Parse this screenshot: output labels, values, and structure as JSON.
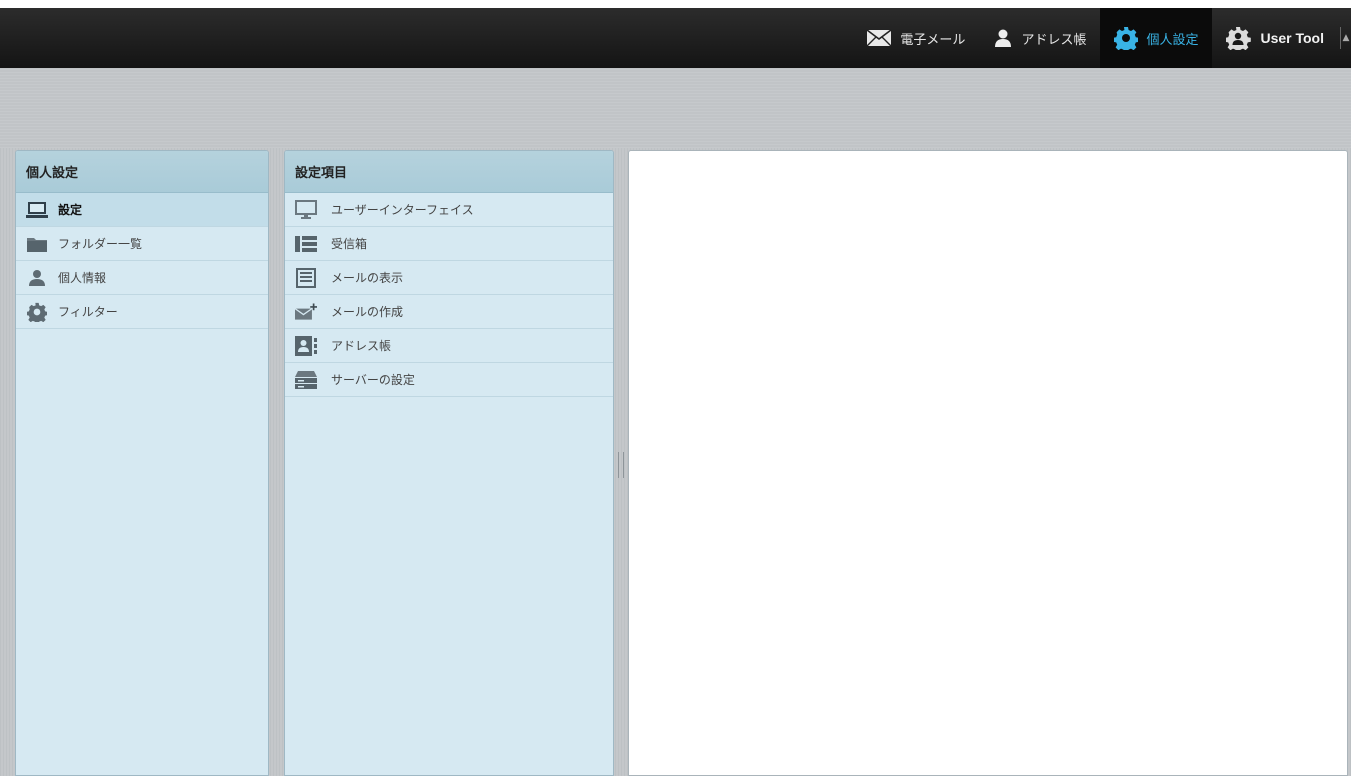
{
  "topnav": {
    "items": [
      {
        "label": "電子メール",
        "icon": "envelope-icon"
      },
      {
        "label": "アドレス帳",
        "icon": "person-icon"
      },
      {
        "label": "個人設定",
        "icon": "gear-icon",
        "active": true
      },
      {
        "label": "User Tool",
        "icon": "user-gear-icon"
      }
    ]
  },
  "left_panel": {
    "title": "個人設定",
    "items": [
      {
        "label": "設定",
        "icon": "monitor-icon",
        "selected": true
      },
      {
        "label": "フォルダー一覧",
        "icon": "folder-icon"
      },
      {
        "label": "個人情報",
        "icon": "person-icon"
      },
      {
        "label": "フィルター",
        "icon": "gear-icon"
      }
    ]
  },
  "mid_panel": {
    "title": "設定項目",
    "items": [
      {
        "label": "ユーザーインターフェイス",
        "icon": "monitor-icon"
      },
      {
        "label": "受信箱",
        "icon": "inbox-icon"
      },
      {
        "label": "メールの表示",
        "icon": "message-view-icon"
      },
      {
        "label": "メールの作成",
        "icon": "compose-mail-icon"
      },
      {
        "label": "アドレス帳",
        "icon": "contact-card-icon"
      },
      {
        "label": "サーバーの設定",
        "icon": "server-icon"
      }
    ]
  },
  "colors": {
    "topbar": "#1c1c1c",
    "active_nav_text": "#39b3e6",
    "panel_bg": "#d6e9f2",
    "panel_header": "#afcfdb"
  }
}
